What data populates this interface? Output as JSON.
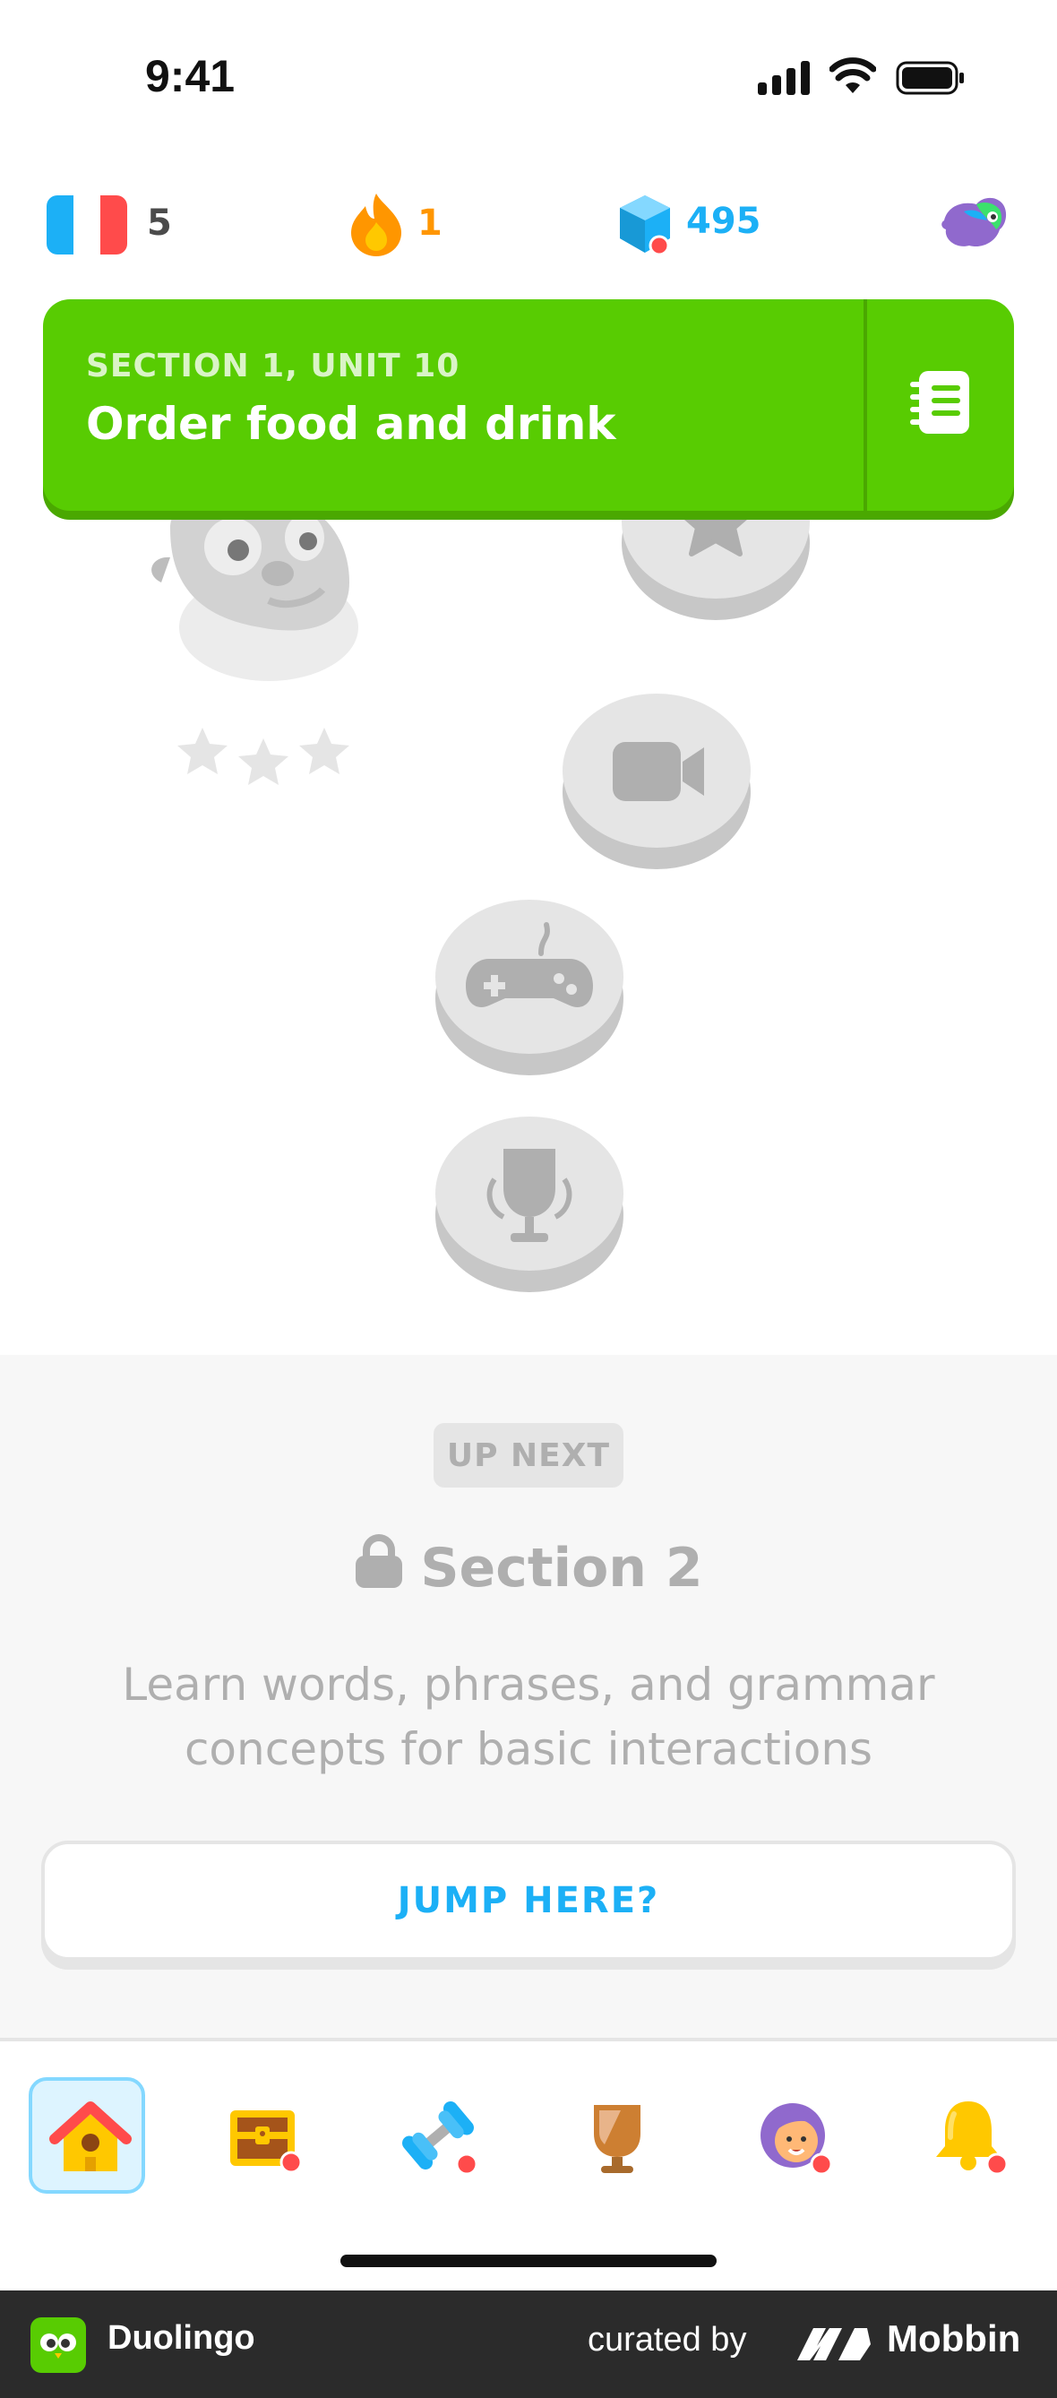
{
  "status_bar": {
    "time": "9:41"
  },
  "stats": {
    "language_count": "5",
    "streak": "1",
    "gems": "495"
  },
  "unit": {
    "kicker": "SECTION 1, UNIT 10",
    "title": "Order food and drink"
  },
  "path_nodes": [
    {
      "icon": "star-icon"
    },
    {
      "icon": "video-icon"
    },
    {
      "icon": "gamepad-icon"
    },
    {
      "icon": "trophy-icon"
    }
  ],
  "up_next": {
    "tag": "UP NEXT",
    "section_title": "Section 2",
    "description": "Learn words, phrases, and grammar concepts for basic interactions",
    "jump_label": "JUMP HERE?"
  },
  "tabs": [
    {
      "icon": "home-icon",
      "active": true
    },
    {
      "icon": "treasure-chest-icon",
      "active": false
    },
    {
      "icon": "dumbbell-icon",
      "active": false
    },
    {
      "icon": "trophy-icon",
      "active": false
    },
    {
      "icon": "profile-icon",
      "active": false
    },
    {
      "icon": "bell-icon",
      "active": false
    }
  ],
  "footer": {
    "app_name": "Duolingo",
    "curated_by": "curated by",
    "brand": "Mobbin"
  },
  "colors": {
    "green": "#58cc02",
    "blue": "#1cb0f6",
    "orange": "#ff9600",
    "gray": "#afafaf"
  }
}
